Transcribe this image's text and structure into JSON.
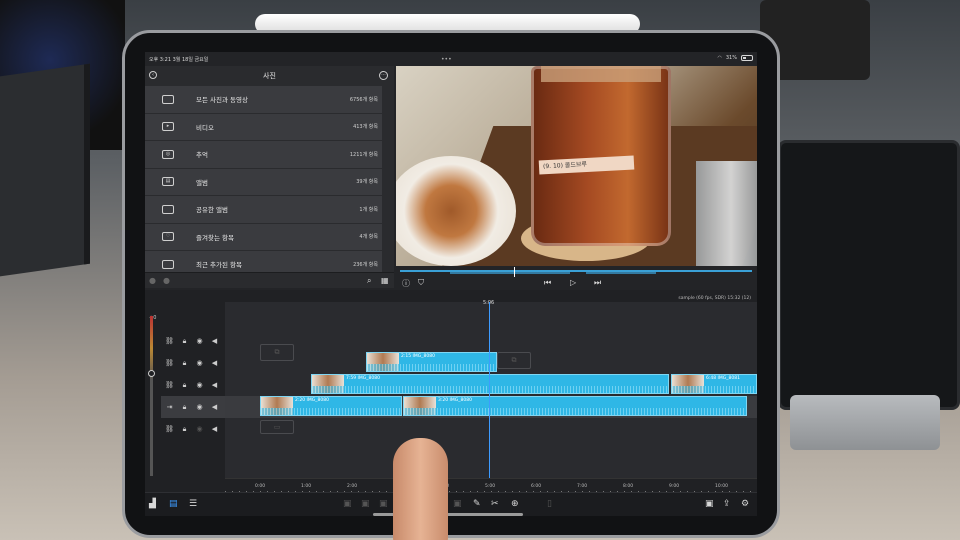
{
  "status": {
    "time": "오후 3:21",
    "date": "3월 18일 금요일",
    "battery": "31%"
  },
  "photos": {
    "title": "사진",
    "albums": [
      {
        "name": "모든 사진과 동영상",
        "count": "6756개 항목",
        "icon": "photo-library-icon"
      },
      {
        "name": "비디오",
        "count": "413개 항목",
        "icon": "video-camera-icon"
      },
      {
        "name": "추억",
        "count": "1211개 항목",
        "icon": "memories-icon"
      },
      {
        "name": "앨범",
        "count": "39개 항목",
        "icon": "album-stack-icon"
      },
      {
        "name": "공유한 앨범",
        "count": "1개 항목",
        "icon": "shared-folder-icon"
      },
      {
        "name": "즐겨찾는 항목",
        "count": "4개 항목",
        "icon": "favorites-icon"
      },
      {
        "name": "최근 추가된 항목",
        "count": "236개 항목",
        "icon": "recent-folder-icon"
      }
    ]
  },
  "preview": {
    "label_text": "(9. 10) 콜드브루"
  },
  "timeline": {
    "meta": "sample (60 fps, SDR) 15:32 (12)",
    "playhead": "5:06",
    "level_label": "+0",
    "clips": [
      {
        "label": "2:15 IMG_8080"
      },
      {
        "label": "7:59 IMG_8080"
      },
      {
        "label": "6:48 IMG_8081"
      },
      {
        "label": "2:20 IMG_8080"
      },
      {
        "label": "3:20 IMG_8080"
      }
    ],
    "ruler": [
      "0:00",
      "1:00",
      "2:00",
      "3:00",
      "4:00",
      "5:00",
      "6:00",
      "7:00",
      "8:00",
      "9:00",
      "10:00"
    ]
  },
  "colors": {
    "clip": "#2fb7e6",
    "playhead": "#3d9bff",
    "panel": "#2a2b2e"
  }
}
